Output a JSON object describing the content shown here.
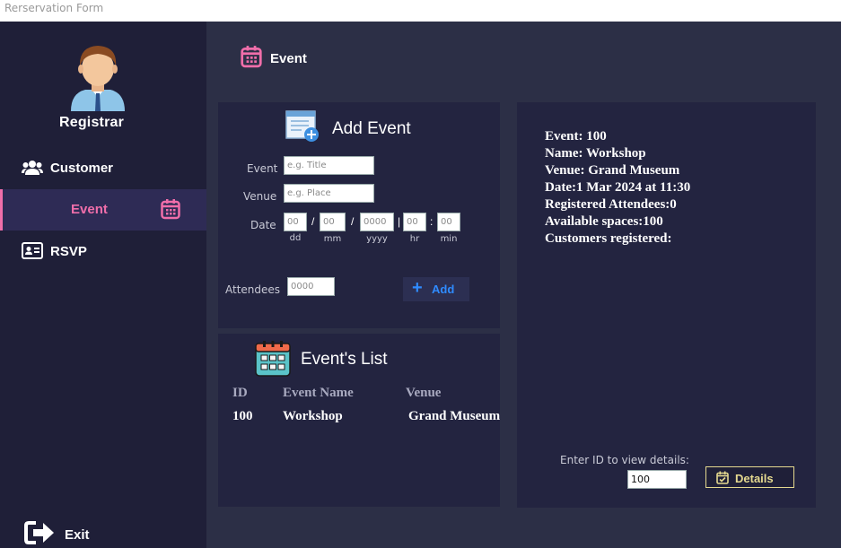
{
  "window": {
    "title": "Rerservation Form"
  },
  "sidebar": {
    "user_label": "Registrar",
    "items": [
      {
        "label": "Customer",
        "icon": "users-icon",
        "active": false
      },
      {
        "label": "Event",
        "icon": "calendar-icon",
        "active": true
      },
      {
        "label": "RSVP",
        "icon": "id-card-icon",
        "active": false
      }
    ],
    "exit_label": "Exit"
  },
  "header": {
    "title": "Event",
    "icon": "calendar-icon"
  },
  "add_event": {
    "title": "Add Event",
    "event_label": "Event",
    "event_placeholder": "e.g. Title",
    "venue_label": "Venue",
    "venue_placeholder": "e.g. Place",
    "date_label": "Date",
    "date_fields": {
      "dd": {
        "placeholder": "00",
        "sub": "dd"
      },
      "mm": {
        "placeholder": "00",
        "sub": "mm"
      },
      "yyyy": {
        "placeholder": "0000",
        "sub": "yyyy"
      },
      "hr": {
        "placeholder": "00",
        "sub": "hr"
      },
      "min": {
        "placeholder": "00",
        "sub": "min"
      }
    },
    "sep_slash": "/",
    "sep_bar": "|",
    "sep_colon": ":",
    "attendees_label": "Attendees",
    "attendees_placeholder": "0000",
    "add_button_label": "Add"
  },
  "events_list": {
    "title": "Event's List",
    "columns": [
      "ID",
      "Event Name",
      "Venue"
    ],
    "rows": [
      {
        "id": "100",
        "name": "Workshop",
        "venue": "Grand Museum"
      }
    ]
  },
  "details": {
    "lines": [
      "Event: 100",
      "Name: Workshop",
      "Venue: Grand Museum",
      "Date:1 Mar 2024 at 11:30",
      "Registered Attendees:0",
      "Available spaces:100",
      "Customers registered:"
    ],
    "enter_id_label": "Enter ID to view details:",
    "id_value": "100",
    "button_label": "Details"
  },
  "colors": {
    "accent_pink": "#f06eaa",
    "accent_blue": "#2f8bff",
    "accent_gold": "#e5d98f",
    "sidebar_bg": "#1f1f38",
    "panel_bg": "#232440",
    "content_bg": "#2c2f46"
  }
}
